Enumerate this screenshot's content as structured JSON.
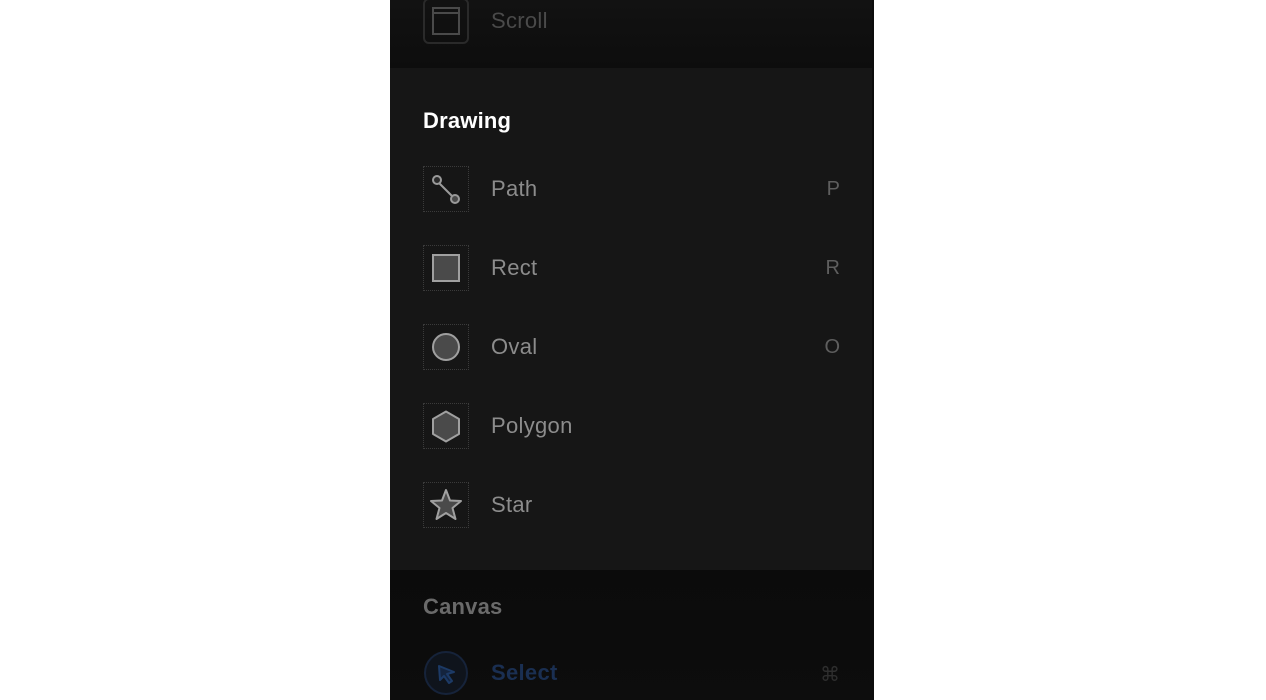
{
  "top_section": {
    "item": {
      "label": "Scroll",
      "icon": "scroll-frame-icon"
    }
  },
  "drawing": {
    "heading": "Drawing",
    "items": [
      {
        "label": "Path",
        "shortcut": "P",
        "icon": "path-icon"
      },
      {
        "label": "Rect",
        "shortcut": "R",
        "icon": "rectangle-icon"
      },
      {
        "label": "Oval",
        "shortcut": "O",
        "icon": "oval-icon"
      },
      {
        "label": "Polygon",
        "shortcut": "",
        "icon": "polygon-icon"
      },
      {
        "label": "Star",
        "shortcut": "",
        "icon": "star-icon"
      }
    ]
  },
  "canvas": {
    "heading": "Canvas",
    "items": [
      {
        "label": "Select",
        "shortcut": "⌘",
        "icon": "select-cursor-icon"
      }
    ]
  },
  "colors": {
    "panel_bg": "#161616",
    "heading_active": "#ffffff",
    "heading_inactive": "#6a6a6a",
    "label": "#8c8c8c",
    "shortcut": "#5e5e5e",
    "icon_fill": "#4a4a4a",
    "icon_stroke": "#9a9a9a",
    "select_accent": "#1c3a66"
  }
}
